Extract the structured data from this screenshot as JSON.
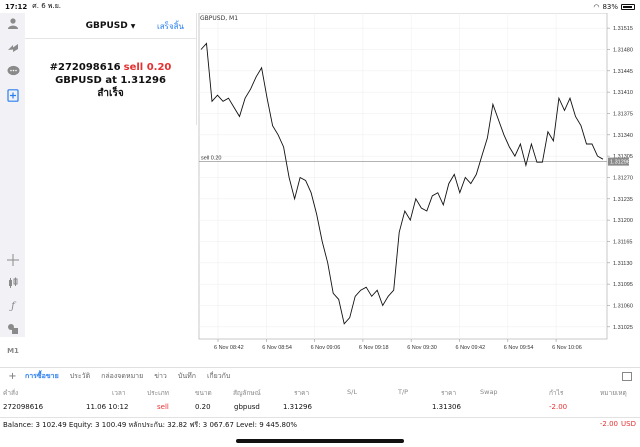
{
  "status_bar": {
    "time": "17:12",
    "date": "ศ. 6 พ.ย.",
    "battery": "83%"
  },
  "toolbar": {
    "items": [
      {
        "icon": "user-icon"
      },
      {
        "icon": "share-icon"
      },
      {
        "icon": "chat-icon"
      },
      {
        "icon": "new-order-icon",
        "active": true
      },
      {
        "icon": "crosshair-icon"
      },
      {
        "icon": "candles-icon"
      },
      {
        "icon": "function-icon"
      },
      {
        "icon": "objects-icon"
      },
      {
        "label": "M1"
      }
    ]
  },
  "order_panel": {
    "symbol": "GBPUSD",
    "caret": "▼",
    "done_label": "เสร็จสิ้น",
    "ticket": "#272098616",
    "type": "sell 0.20",
    "line2": "GBPUSD at 1.31296",
    "status": "สำเร็จ"
  },
  "chart_data": {
    "type": "line",
    "title": "GBPUSD, M1",
    "x": [
      "6 Nov 08:42",
      "6 Nov 08:54",
      "6 Nov 09:06",
      "6 Nov 09:18",
      "6 Nov 09:30",
      "6 Nov 09:42",
      "6 Nov 09:54",
      "6 Nov 10:06"
    ],
    "x_tick_labels": [
      "6 Nov 08:42",
      "6 Nov 08:54",
      "6 Nov 09:06",
      "6 Nov 09:18",
      "6 Nov 09:30",
      "6 Nov 09:42",
      "6 Nov 09:54",
      "6 Nov 10:06"
    ],
    "y_tick_labels": [
      "1.31515",
      "1.31480",
      "1.31445",
      "1.31410",
      "1.31375",
      "1.31340",
      "1.31305",
      "1.31270",
      "1.31235",
      "1.31200",
      "1.31165",
      "1.31130",
      "1.31095",
      "1.31060",
      "1.31025"
    ],
    "ylim": [
      1.31005,
      1.3153
    ],
    "series": [
      {
        "values": [
          1.3148,
          1.3149,
          1.31395,
          1.31405,
          1.31395,
          1.314,
          1.31385,
          1.3137,
          1.314,
          1.31415,
          1.31435,
          1.3145,
          1.314,
          1.31355,
          1.3134,
          1.3132,
          1.3127,
          1.31235,
          1.3127,
          1.31265,
          1.31245,
          1.3121,
          1.31165,
          1.3113,
          1.3108,
          1.3107,
          1.3103,
          1.3104,
          1.31075,
          1.31085,
          1.3109,
          1.31075,
          1.31085,
          1.3106,
          1.31075,
          1.31085,
          1.3118,
          1.31215,
          1.312,
          1.31235,
          1.3122,
          1.31215,
          1.3124,
          1.31245,
          1.31225,
          1.3126,
          1.31275,
          1.31245,
          1.3127,
          1.3126,
          1.31275,
          1.31305,
          1.31335,
          1.3139,
          1.31365,
          1.3134,
          1.3132,
          1.31305,
          1.31325,
          1.3129,
          1.31325,
          1.31295,
          1.31295,
          1.31345,
          1.3133,
          1.314,
          1.3138,
          1.314,
          1.3137,
          1.31355,
          1.31325,
          1.31325,
          1.31305,
          1.313
        ]
      }
    ],
    "level_line": {
      "label": "sell 0.20",
      "value": 1.31296,
      "price_label": "1.31296"
    },
    "grid": true
  },
  "tabs": {
    "items": [
      "การซื้อขาย",
      "ประวัติ",
      "กล่องจดหมาย",
      "ข่าว",
      "บันทึก",
      "เกี่ยวกับ"
    ]
  },
  "columns": {
    "order": "คำสั่ง",
    "time": "เวลา",
    "type": "ประเภท",
    "size": "ขนาด",
    "symbol": "สัญลักษณ์",
    "price": "ราคา",
    "sl": "S/L",
    "tp": "T/P",
    "price2": "ราคา",
    "swap": "Swap",
    "profit": "กำไร",
    "comment": "หมายเหตุ"
  },
  "order_row": {
    "ticket": "272098616",
    "time": "11.06 10:12",
    "type": "sell",
    "size": "0.20",
    "symbol": "gbpusd",
    "price": "1.31296",
    "current": "1.31306",
    "profit": "-2.00"
  },
  "balance": {
    "text": "Balance: 3 102.49 Equity: 3 100.49 หลักประกัน: 32.82 ฟรี: 3 067.67 Level: 9 445.80%",
    "profit": "-2.00",
    "currency": "USD"
  }
}
